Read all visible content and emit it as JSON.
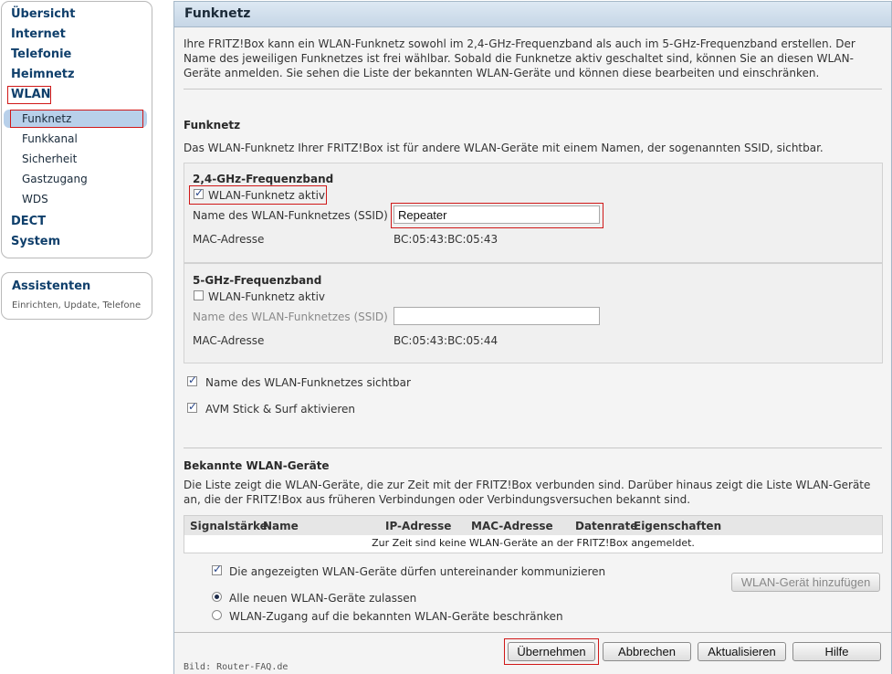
{
  "sidebar": {
    "items": [
      {
        "label": "Übersicht"
      },
      {
        "label": "Internet"
      },
      {
        "label": "Telefonie"
      },
      {
        "label": "Heimnetz"
      },
      {
        "label": "WLAN"
      },
      {
        "label": "DECT"
      },
      {
        "label": "System"
      }
    ],
    "wlan_sub": [
      {
        "label": "Funknetz"
      },
      {
        "label": "Funkkanal"
      },
      {
        "label": "Sicherheit"
      },
      {
        "label": "Gastzugang"
      },
      {
        "label": "WDS"
      }
    ],
    "assistant": {
      "title": "Assistenten",
      "subtitle": "Einrichten, Update, Telefone"
    }
  },
  "panel": {
    "title": "Funknetz",
    "intro": "Ihre FRITZ!Box kann ein WLAN-Funknetz sowohl im 2,4-GHz-Frequenzband als auch im 5-GHz-Frequenzband erstellen. Der Name des jeweiligen Funknetzes ist frei wählbar. Sobald die Funknetze aktiv geschaltet sind, können Sie an diesen WLAN-Geräte anmelden. Sie sehen die Liste der bekannten WLAN-Geräte und können diese bearbeiten und einschränken.",
    "section_title": "Funknetz",
    "section_desc": "Das WLAN-Funknetz Ihrer FRITZ!Box ist für andere WLAN-Geräte mit einem Namen, der sogenannten SSID, sichtbar.",
    "band24": {
      "title": "2,4-GHz-Frequenzband",
      "active_label": "WLAN-Funknetz aktiv",
      "active_checked": true,
      "ssid_label": "Name des WLAN-Funknetzes (SSID)",
      "ssid_value": "Repeater",
      "mac_label": "MAC-Adresse",
      "mac_value": "BC:05:43:BC:05:43"
    },
    "band5": {
      "title": "5-GHz-Frequenzband",
      "active_label": "WLAN-Funknetz aktiv",
      "active_checked": false,
      "ssid_label": "Name des WLAN-Funknetzes (SSID)",
      "ssid_value": "",
      "mac_label": "MAC-Adresse",
      "mac_value": "BC:05:43:BC:05:44"
    },
    "visible_label": "Name des WLAN-Funknetzes sichtbar",
    "stick_label": "AVM Stick & Surf aktivieren",
    "known": {
      "title": "Bekannte WLAN-Geräte",
      "desc": "Die Liste zeigt die WLAN-Geräte, die zur Zeit mit der FRITZ!Box verbunden sind. Darüber hinaus zeigt die Liste WLAN-Geräte an, die der FRITZ!Box aus früheren Verbindungen oder Verbindungsversuchen bekannt sind.",
      "columns": [
        "Signalstärke",
        "Name",
        "IP-Adresse",
        "MAC-Adresse",
        "Datenrate",
        "Eigenschaften"
      ],
      "empty": "Zur Zeit sind keine WLAN-Geräte an der FRITZ!Box angemeldet.",
      "communicate_label": "Die angezeigten WLAN-Geräte dürfen untereinander kommunizieren",
      "add_button": "WLAN-Gerät hinzufügen",
      "radio_all": "Alle neuen WLAN-Geräte zulassen",
      "radio_restrict": "WLAN-Zugang auf die bekannten WLAN-Geräte beschränken"
    },
    "buttons": {
      "apply": "Übernehmen",
      "cancel": "Abbrechen",
      "refresh": "Aktualisieren",
      "help": "Hilfe"
    },
    "credit": "Bild: Router-FAQ.de"
  },
  "colors": {
    "highlight": "#d01818",
    "selection": "#b8d0ea",
    "nav_text": "#0f3f6b"
  }
}
